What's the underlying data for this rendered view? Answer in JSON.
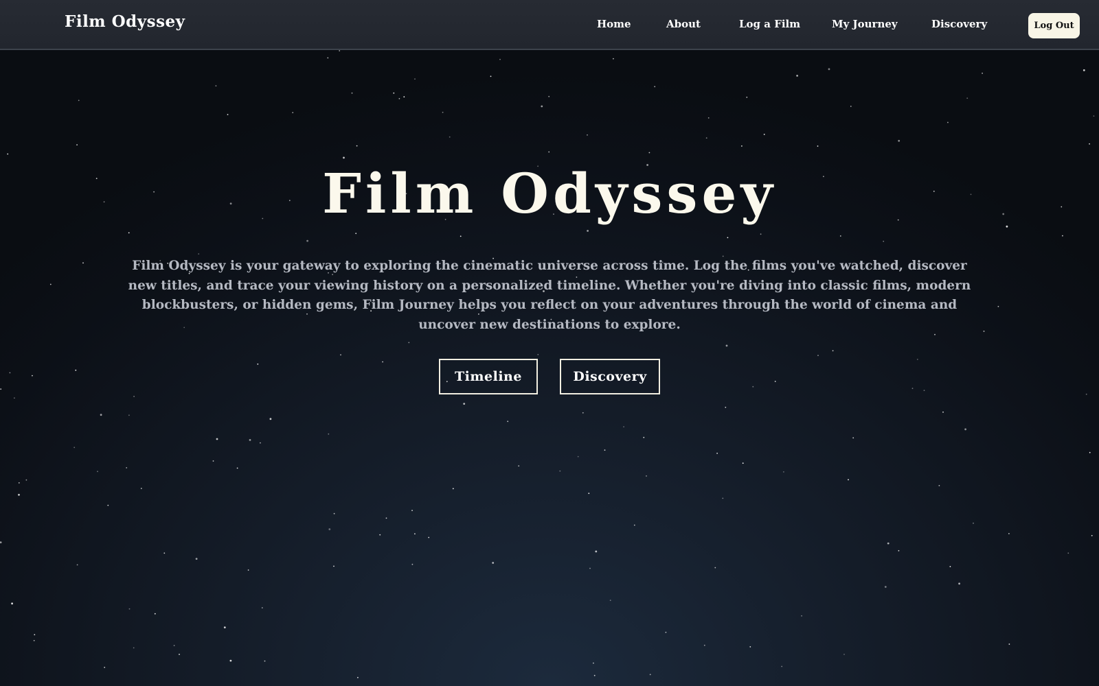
{
  "navbar": {
    "brand": "Film Odyssey",
    "links": [
      {
        "label": "Home"
      },
      {
        "label": "About"
      },
      {
        "label": "Log a Film"
      },
      {
        "label": "My Journey"
      },
      {
        "label": "Discovery"
      }
    ],
    "logout_label": "Log Out"
  },
  "hero": {
    "title": "Film Odyssey",
    "description": "Film Odyssey is your gateway to exploring the cinematic universe across time. Log the films you've watched, discover new titles, and trace your viewing history on a personalized timeline. Whether you're diving into classic films, modern blockbusters, or hidden gems, Film Journey helps you reflect on your adventures through the world of cinema and uncover new destinations to explore.",
    "buttons": {
      "timeline_label": "Timeline",
      "discovery_label": "Discovery"
    }
  },
  "colors": {
    "background": "#0c1017",
    "navbar": "#262a32",
    "text_primary": "#fbf8ec",
    "text_secondary": "#b5b9c2",
    "logout_bg": "#f8f5e6"
  }
}
